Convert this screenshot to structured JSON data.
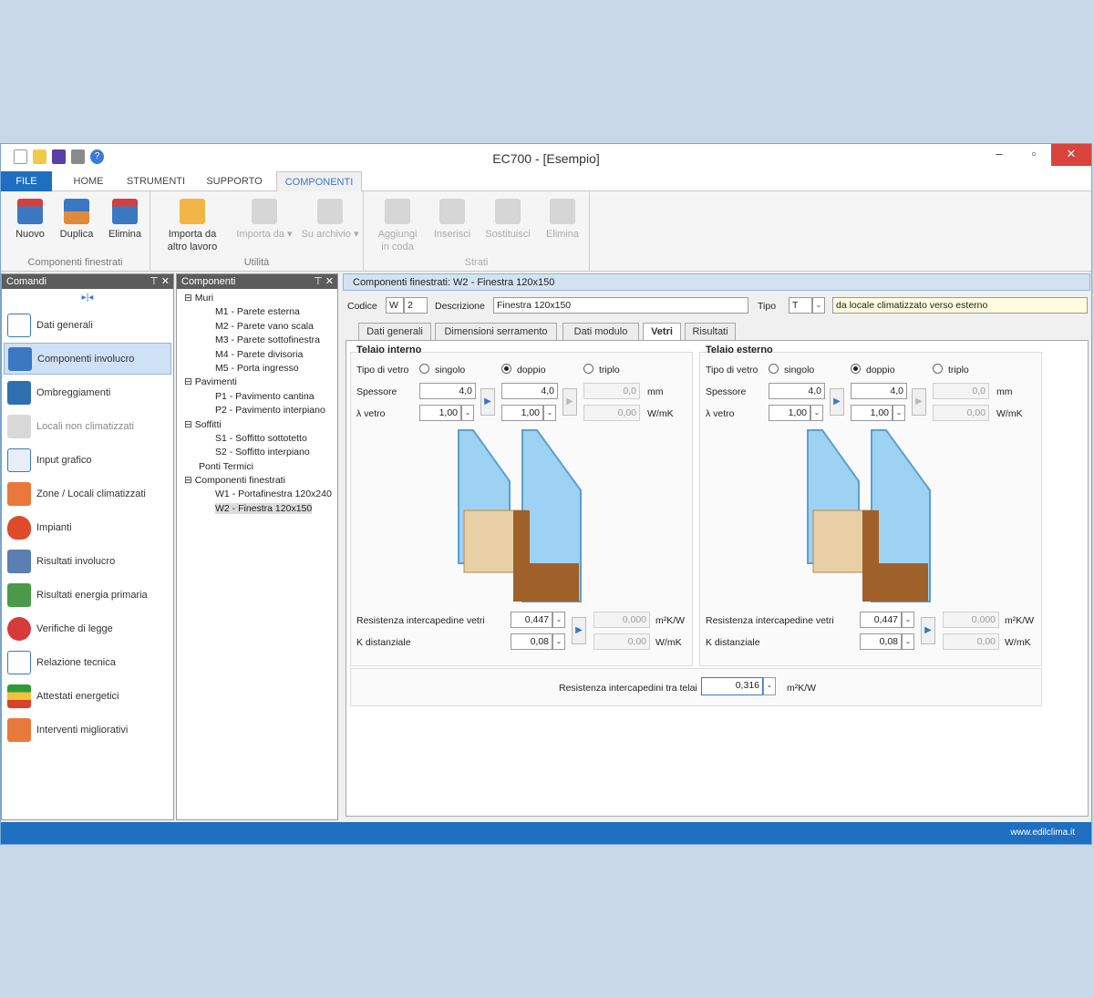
{
  "app": {
    "title": "EC700 - [Esempio]"
  },
  "window": {
    "minimize": "–",
    "maximize": "▫",
    "close": "✕"
  },
  "tabs": [
    "FILE",
    "HOME",
    "STRUMENTI",
    "SUPPORTO",
    "COMPONENTI"
  ],
  "ribbon": {
    "group1": {
      "name": "Componenti finestrati",
      "buttons": [
        "Nuovo",
        "Duplica",
        "Elimina"
      ]
    },
    "group2": {
      "name": "Utilità",
      "buttons": [
        "Importa da",
        "altro lavoro",
        "Importa da ▾",
        "Su archivio ▾"
      ]
    },
    "group3": {
      "name": "Strati",
      "buttons": [
        "Aggiungi",
        "in coda",
        "Inserisci",
        "Sostituisci",
        "Elimina"
      ]
    }
  },
  "comandi": {
    "title": "Comandi",
    "pin": "⊤ ✕",
    "collapse": "▸|◂",
    "items": [
      "Dati generali",
      "Componenti involucro",
      "Ombreggiamenti",
      "Locali non climatizzati",
      "Input grafico",
      "Zone / Locali climatizzati",
      "Impianti",
      "Risultati involucro",
      "Risultati energia primaria",
      "Verifiche di legge",
      "Relazione tecnica",
      "Attestati energetici",
      "Interventi migliorativi"
    ]
  },
  "componenti": {
    "title": "Componenti",
    "pin": "⊤ ✕",
    "tree": [
      "⊟ Muri",
      "M1 - Parete esterna",
      "M2 - Parete vano scala",
      "M3 - Parete sottofinestra",
      "M4 - Parete divisoria",
      "M5 - Porta ingresso",
      "⊟ Pavimenti",
      "P1 - Pavimento cantina",
      "P2 - Pavimento interpiano",
      "⊟ Soffitti",
      "S1 - Soffitto sottotetto",
      "S2 - Soffitto interpiano",
      "Ponti Termici",
      "⊟ Componenti finestrati",
      "W1 - Portafinestra 120x240",
      "W2 - Finestra 120x150"
    ]
  },
  "main": {
    "header": "Componenti finestrati: W2 - Finestra 120x150",
    "codice_label": "Codice",
    "codice_prefix": "W",
    "codice_num": "2",
    "descr_label": "Descrizione",
    "descr_value": "Finestra 120x150",
    "tipo_label": "Tipo",
    "tipo_value": "T",
    "tipo_desc": "da locale climatizzato verso esterno",
    "subtabs": [
      "Dati generali",
      "Dimensioni serramento",
      "Dati modulo",
      "Vetri",
      "Risultati"
    ],
    "left": {
      "title": "Telaio interno",
      "tipo_vetro": "Tipo di vetro",
      "singolo": "singolo",
      "doppio": "doppio",
      "triplo": "triplo",
      "spessore": "Spessore",
      "sp1": "4,0",
      "sp2": "4,0",
      "sp3": "0,0",
      "unit_mm": "mm",
      "lambda": "λ vetro",
      "l1": "1,00",
      "l2": "1,00",
      "l3": "0,00",
      "unit_wmk": "W/mK",
      "res_label": "Resistenza intercapedine vetri",
      "res1": "0,447",
      "res2": "0,000",
      "unit_res": "m²K/W",
      "k_label": "K distanziale",
      "k1": "0,08",
      "k2": "0,00",
      "unit_k": "W/mK"
    },
    "right": {
      "title": "Telaio esterno",
      "tipo_vetro": "Tipo di vetro",
      "singolo": "singolo",
      "doppio": "doppio",
      "triplo": "triplo",
      "spessore": "Spessore",
      "sp1": "4,0",
      "sp2": "4,0",
      "sp3": "0,0",
      "unit_mm": "mm",
      "lambda": "λ vetro",
      "l1": "1,00",
      "l2": "1,00",
      "l3": "0,00",
      "unit_wmk": "W/mK",
      "res_label": "Resistenza intercapedine vetri",
      "res1": "0,447",
      "res2": "0,000",
      "unit_res": "m²K/W",
      "k_label": "K distanziale",
      "k1": "0,08",
      "k2": "0,00",
      "unit_k": "W/mK"
    },
    "telai_label": "Resistenza intercapedini tra telai",
    "telai_value": "0,316",
    "telai_unit": "m²K/W",
    "dd": "⌄",
    "arrow": "▶"
  },
  "status": {
    "url": "www.edilclima.it"
  },
  "colors": {
    "accent": "#1e6fbf",
    "selection": "#cfe1f5"
  }
}
